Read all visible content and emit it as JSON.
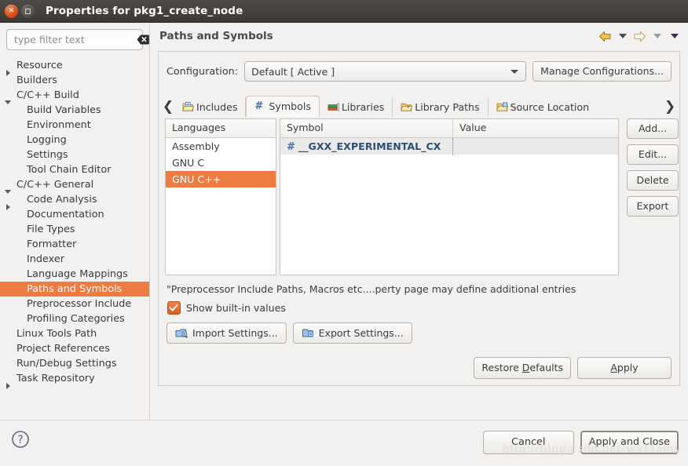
{
  "window": {
    "title": "Properties for pkg1_create_node",
    "close_icon": "close-icon",
    "maximize_icon": "maximize-icon"
  },
  "filter": {
    "placeholder": "type filter text",
    "value": "",
    "clear_icon": "clear-icon"
  },
  "sidebar": {
    "items": [
      {
        "label": "Resource",
        "level": 1,
        "twisty": "collapsed",
        "selected": false
      },
      {
        "label": "Builders",
        "level": 1,
        "twisty": "none",
        "selected": false
      },
      {
        "label": "C/C++ Build",
        "level": 1,
        "twisty": "expanded",
        "selected": false
      },
      {
        "label": "Build Variables",
        "level": 2,
        "twisty": "none",
        "selected": false
      },
      {
        "label": "Environment",
        "level": 2,
        "twisty": "none",
        "selected": false
      },
      {
        "label": "Logging",
        "level": 2,
        "twisty": "none",
        "selected": false
      },
      {
        "label": "Settings",
        "level": 2,
        "twisty": "none",
        "selected": false
      },
      {
        "label": "Tool Chain Editor",
        "level": 2,
        "twisty": "none",
        "selected": false
      },
      {
        "label": "C/C++ General",
        "level": 1,
        "twisty": "expanded",
        "selected": false
      },
      {
        "label": "Code Analysis",
        "level": 2,
        "twisty": "collapsed",
        "selected": false
      },
      {
        "label": "Documentation",
        "level": 2,
        "twisty": "none",
        "selected": false
      },
      {
        "label": "File Types",
        "level": 2,
        "twisty": "none",
        "selected": false
      },
      {
        "label": "Formatter",
        "level": 2,
        "twisty": "none",
        "selected": false
      },
      {
        "label": "Indexer",
        "level": 2,
        "twisty": "none",
        "selected": false
      },
      {
        "label": "Language Mappings",
        "level": 2,
        "twisty": "none",
        "selected": false
      },
      {
        "label": "Paths and Symbols",
        "level": 2,
        "twisty": "none",
        "selected": true
      },
      {
        "label": "Preprocessor Include",
        "level": 2,
        "twisty": "none",
        "selected": false
      },
      {
        "label": "Profiling Categories",
        "level": 2,
        "twisty": "none",
        "selected": false
      },
      {
        "label": "Linux Tools Path",
        "level": 1,
        "twisty": "none",
        "selected": false
      },
      {
        "label": "Project References",
        "level": 1,
        "twisty": "none",
        "selected": false
      },
      {
        "label": "Run/Debug Settings",
        "level": 1,
        "twisty": "none",
        "selected": false
      },
      {
        "label": "Task Repository",
        "level": 1,
        "twisty": "collapsed",
        "selected": false
      }
    ]
  },
  "page": {
    "title": "Paths and Symbols",
    "nav": {
      "back_icon": "back-arrow-icon",
      "back_menu_icon": "chevron-down-icon",
      "forward_icon": "forward-arrow-icon",
      "forward_menu_icon": "chevron-down-icon",
      "view_menu_icon": "chevron-down-icon"
    }
  },
  "configuration": {
    "label": "Configuration:",
    "selected": "Default  [ Active ]",
    "options": [
      "Default  [ Active ]"
    ],
    "manage_label": "Manage Configurations...",
    "dropdown_icon": "chevron-down-icon"
  },
  "tabs": {
    "scroll_left_icon": "chevron-left-icon",
    "scroll_right_icon": "chevron-right-icon",
    "items": [
      {
        "label": "Includes",
        "icon": "folder-include-icon",
        "active": false
      },
      {
        "label": "Symbols",
        "icon": "hash-icon",
        "active": true
      },
      {
        "label": "Libraries",
        "icon": "books-icon",
        "active": false
      },
      {
        "label": "Library Paths",
        "icon": "folder-open-icon",
        "active": false
      },
      {
        "label": "Source Location",
        "icon": "folder-source-icon",
        "active": false
      }
    ]
  },
  "languages_table": {
    "header": "Languages",
    "rows": [
      {
        "label": "Assembly",
        "selected": false
      },
      {
        "label": "GNU C",
        "selected": false
      },
      {
        "label": "GNU C++",
        "selected": true
      }
    ]
  },
  "symbols_table": {
    "headers": {
      "symbol": "Symbol",
      "value": "Value"
    },
    "rows": [
      {
        "icon": "hash-icon",
        "symbol": "__GXX_EXPERIMENTAL_CX",
        "value": ""
      }
    ]
  },
  "entry_buttons": [
    {
      "label": "Add..."
    },
    {
      "label": "Edit..."
    },
    {
      "label": "Delete"
    },
    {
      "label": "Export"
    }
  ],
  "note": "\"Preprocessor Include Paths, Macros etc....perty page may define additional entries",
  "show_builtin": {
    "label": "Show built-in values",
    "checked": true
  },
  "settings_buttons": [
    {
      "label": "Import Settings...",
      "icon": "import-settings-icon"
    },
    {
      "label": "Export Settings...",
      "icon": "export-settings-icon"
    }
  ],
  "apply_row": {
    "restore_defaults_pre": "Restore ",
    "restore_defaults_mnemonic": "D",
    "restore_defaults_post": "efaults",
    "apply_mnemonic": "A",
    "apply_post": "pply"
  },
  "bottom": {
    "help_icon": "help-icon",
    "cancel_label": "Cancel",
    "apply_and_close_label": "Apply and Close"
  },
  "watermark": "http://blog.csdn.net/wxf1amy",
  "colors": {
    "selection": "#ed7b42",
    "titlebar": "#3c3936",
    "close_button": "#dd4814",
    "symbol_text": "#2d4f73"
  }
}
